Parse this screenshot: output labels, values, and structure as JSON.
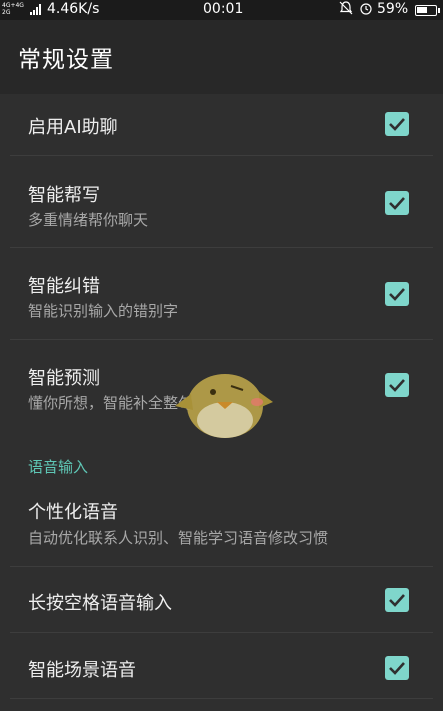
{
  "status_bar": {
    "network_label_top": "4G+4G",
    "network_label_bottom": "2G",
    "speed": "4.46K/s",
    "time": "00:01",
    "icons": "🔕 ⏰",
    "battery_percent": "59%",
    "battery_level": 0.59
  },
  "app_bar": {
    "title": "常规设置"
  },
  "settings": [
    {
      "title": "启用AI助聊",
      "subtitle": "",
      "checked": true
    },
    {
      "title": "智能帮写",
      "subtitle": "多重情绪帮你聊天",
      "checked": true
    },
    {
      "title": "智能纠错",
      "subtitle": "智能识别输入的错别字",
      "checked": true
    },
    {
      "title": "智能预测",
      "subtitle": "懂你所想，智能补全整句",
      "checked": true
    }
  ],
  "voice_section": {
    "header": "语音输入",
    "items": [
      {
        "title": "个性化语音",
        "subtitle": "自动优化联系人识别、智能学习语音修改习惯"
      },
      {
        "title": "长按空格语音输入",
        "subtitle": "",
        "checked": true
      },
      {
        "title": "智能场景语音",
        "subtitle": "",
        "checked": true
      }
    ]
  },
  "colors": {
    "accent": "#7fd6cb",
    "section_header": "#5fc7b6",
    "background": "#2f2f2f"
  },
  "mascot_icon": "bird-mascot-icon"
}
